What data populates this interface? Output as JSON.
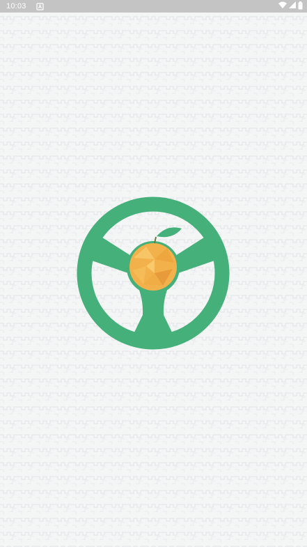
{
  "status_bar": {
    "time": "10:03",
    "notification_icon": "a-square-icon",
    "wifi_icon": "wifi-icon",
    "signal_icon": "signal-icon",
    "battery_icon": "battery-icon"
  },
  "splash": {
    "logo_icon": "steering-wheel-orange-logo",
    "colors": {
      "wheel": "#45b07a",
      "orange": "#f2b24a",
      "leaf": "#45b07a",
      "background": "#f4f5f5"
    }
  }
}
